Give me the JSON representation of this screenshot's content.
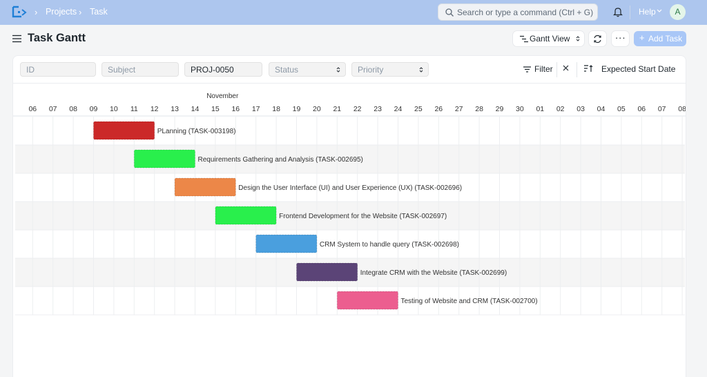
{
  "navbar": {
    "breadcrumbs": [
      "Projects",
      "Task"
    ],
    "search_placeholder": "Search or type a command (Ctrl + G)",
    "help_label": "Help",
    "avatar_initial": "A"
  },
  "page": {
    "title": "Task Gantt",
    "view_button_label": "Gantt View",
    "more_label": "···",
    "add_button_label": "Add Task"
  },
  "filters": {
    "id_placeholder": "ID",
    "subject_placeholder": "Subject",
    "project_value": "PROJ-0050",
    "status_placeholder": "Status",
    "priority_placeholder": "Priority",
    "filter_label": "Filter",
    "sort_label": "Expected Start Date"
  },
  "gantt": {
    "month_label": "November",
    "day_labels": [
      "06",
      "07",
      "08",
      "09",
      "10",
      "11",
      "12",
      "13",
      "14",
      "15",
      "16",
      "17",
      "18",
      "19",
      "20",
      "21",
      "22",
      "23",
      "24",
      "25",
      "26",
      "27",
      "28",
      "29",
      "30",
      "01",
      "02",
      "03",
      "04",
      "05",
      "06",
      "07",
      "08",
      "09"
    ],
    "colors": {
      "grid": "#eceef0",
      "row_alt": "#f5f5f5",
      "text": "#333333",
      "header_text": "#333333"
    },
    "tasks": [
      {
        "label": "PLanning (TASK-003198)",
        "start_index": 3,
        "end_index": 6,
        "color": "#cb2929"
      },
      {
        "label": "Requirements Gathering and Analysis (TASK-002695)",
        "start_index": 5,
        "end_index": 8,
        "color": "#29ef4c"
      },
      {
        "label": "Design the User Interface (UI) and User Experience (UX) (TASK-002696)",
        "start_index": 7,
        "end_index": 10,
        "color": "#ec8748"
      },
      {
        "label": "Frontend Development for the Website (TASK-002697)",
        "start_index": 9,
        "end_index": 12,
        "color": "#29ef4c"
      },
      {
        "label": "CRM System to handle query (TASK-002698)",
        "start_index": 11,
        "end_index": 14,
        "color": "#4a9fde"
      },
      {
        "label": "Integrate CRM with the Website (TASK-002699)",
        "start_index": 13,
        "end_index": 16,
        "color": "#5b4477"
      },
      {
        "label": "Testing of Website and CRM (TASK-002700)",
        "start_index": 15,
        "end_index": 18,
        "color": "#ec5e8f"
      }
    ]
  }
}
